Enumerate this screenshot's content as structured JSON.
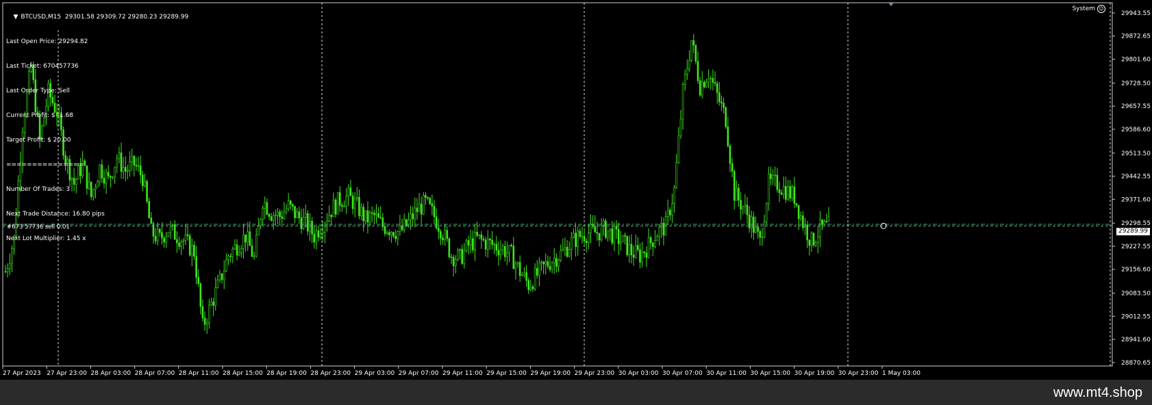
{
  "chart_header": {
    "symbol": "BTCUSD,M15",
    "ohlc": "29301.58 29309.72 29280.23 29289.99",
    "system_label": "System"
  },
  "info_panel": {
    "lines": [
      "Last Open Price: 29294.82",
      "Last Ticket: 670457736",
      "Last Order Type: Sell",
      "Current Profit: $ -1.68",
      "Target Profit: $ 20.00",
      "===============",
      "Number Of Trades: 3",
      "Next Trade Distance: 16.80 pips",
      "Next Lot Multiplier: 1.45 x"
    ]
  },
  "order_line_label": "#673 57736 sell 0.01",
  "current_price_tag": "29289.99",
  "watermark": "www.mt4.shop",
  "colors": {
    "background": "#000000",
    "candles": "#3ee81c",
    "grid": "#ffffff",
    "order_line": "#3cb371"
  },
  "chart_data": {
    "type": "candlestick",
    "symbol": "BTCUSD",
    "timeframe": "M15",
    "y_ticks": [
      "29943.55",
      "29872.65",
      "29801.60",
      "29728.50",
      "29657.55",
      "29586.60",
      "29513.50",
      "29442.55",
      "29371.60",
      "29298.55",
      "29227.55",
      "29156.60",
      "29083.50",
      "29012.55",
      "28941.60",
      "28870.65"
    ],
    "x_ticks": [
      "27 Apr 2023",
      "27 Apr 23:00",
      "28 Apr 03:00",
      "28 Apr 07:00",
      "28 Apr 11:00",
      "28 Apr 15:00",
      "28 Apr 19:00",
      "28 Apr 23:00",
      "29 Apr 03:00",
      "29 Apr 07:00",
      "29 Apr 11:00",
      "29 Apr 15:00",
      "29 Apr 19:00",
      "29 Apr 23:00",
      "30 Apr 03:00",
      "30 Apr 07:00",
      "30 Apr 11:00",
      "30 Apr 15:00",
      "30 Apr 19:00",
      "30 Apr 23:00",
      "1 May 03:00"
    ],
    "ylim": [
      28860,
      29975
    ],
    "order_price": 29294.82,
    "current_price": 29289.99,
    "close_path": [
      [
        0,
        29150
      ],
      [
        4,
        29250
      ],
      [
        8,
        29600
      ],
      [
        12,
        29780
      ],
      [
        16,
        29550
      ],
      [
        20,
        29700
      ],
      [
        24,
        29640
      ],
      [
        28,
        29500
      ],
      [
        32,
        29420
      ],
      [
        36,
        29480
      ],
      [
        40,
        29380
      ],
      [
        44,
        29470
      ],
      [
        48,
        29430
      ],
      [
        52,
        29500
      ],
      [
        56,
        29460
      ],
      [
        60,
        29480
      ],
      [
        64,
        29440
      ],
      [
        68,
        29270
      ],
      [
        72,
        29250
      ],
      [
        76,
        29280
      ],
      [
        80,
        29260
      ],
      [
        84,
        29240
      ],
      [
        88,
        29210
      ],
      [
        92,
        28980
      ],
      [
        96,
        29050
      ],
      [
        100,
        29120
      ],
      [
        104,
        29200
      ],
      [
        108,
        29230
      ],
      [
        112,
        29260
      ],
      [
        116,
        29190
      ],
      [
        120,
        29370
      ],
      [
        124,
        29330
      ],
      [
        128,
        29320
      ],
      [
        132,
        29350
      ],
      [
        136,
        29320
      ],
      [
        140,
        29300
      ],
      [
        144,
        29260
      ],
      [
        148,
        29300
      ],
      [
        152,
        29340
      ],
      [
        156,
        29370
      ],
      [
        160,
        29380
      ],
      [
        164,
        29350
      ],
      [
        168,
        29310
      ],
      [
        172,
        29320
      ],
      [
        176,
        29290
      ],
      [
        180,
        29280
      ],
      [
        184,
        29270
      ],
      [
        188,
        29300
      ],
      [
        192,
        29340
      ],
      [
        196,
        29360
      ],
      [
        200,
        29320
      ],
      [
        204,
        29270
      ],
      [
        208,
        29200
      ],
      [
        212,
        29190
      ],
      [
        216,
        29230
      ],
      [
        220,
        29250
      ],
      [
        224,
        29240
      ],
      [
        228,
        29230
      ],
      [
        232,
        29220
      ],
      [
        236,
        29200
      ],
      [
        240,
        29150
      ],
      [
        244,
        29110
      ],
      [
        248,
        29140
      ],
      [
        252,
        29170
      ],
      [
        256,
        29190
      ],
      [
        260,
        29210
      ],
      [
        264,
        29240
      ],
      [
        268,
        29260
      ],
      [
        272,
        29270
      ],
      [
        276,
        29270
      ],
      [
        280,
        29280
      ],
      [
        284,
        29260
      ],
      [
        288,
        29240
      ],
      [
        292,
        29210
      ],
      [
        296,
        29200
      ],
      [
        300,
        29230
      ],
      [
        304,
        29270
      ],
      [
        308,
        29290
      ],
      [
        312,
        29400
      ],
      [
        316,
        29700
      ],
      [
        320,
        29860
      ],
      [
        324,
        29720
      ],
      [
        328,
        29760
      ],
      [
        332,
        29690
      ],
      [
        336,
        29620
      ],
      [
        340,
        29390
      ],
      [
        344,
        29350
      ],
      [
        348,
        29300
      ],
      [
        352,
        29240
      ],
      [
        356,
        29420
      ],
      [
        360,
        29420
      ],
      [
        364,
        29400
      ],
      [
        368,
        29380
      ],
      [
        372,
        29300
      ],
      [
        376,
        29240
      ],
      [
        380,
        29280
      ],
      [
        384,
        29290
      ]
    ]
  }
}
